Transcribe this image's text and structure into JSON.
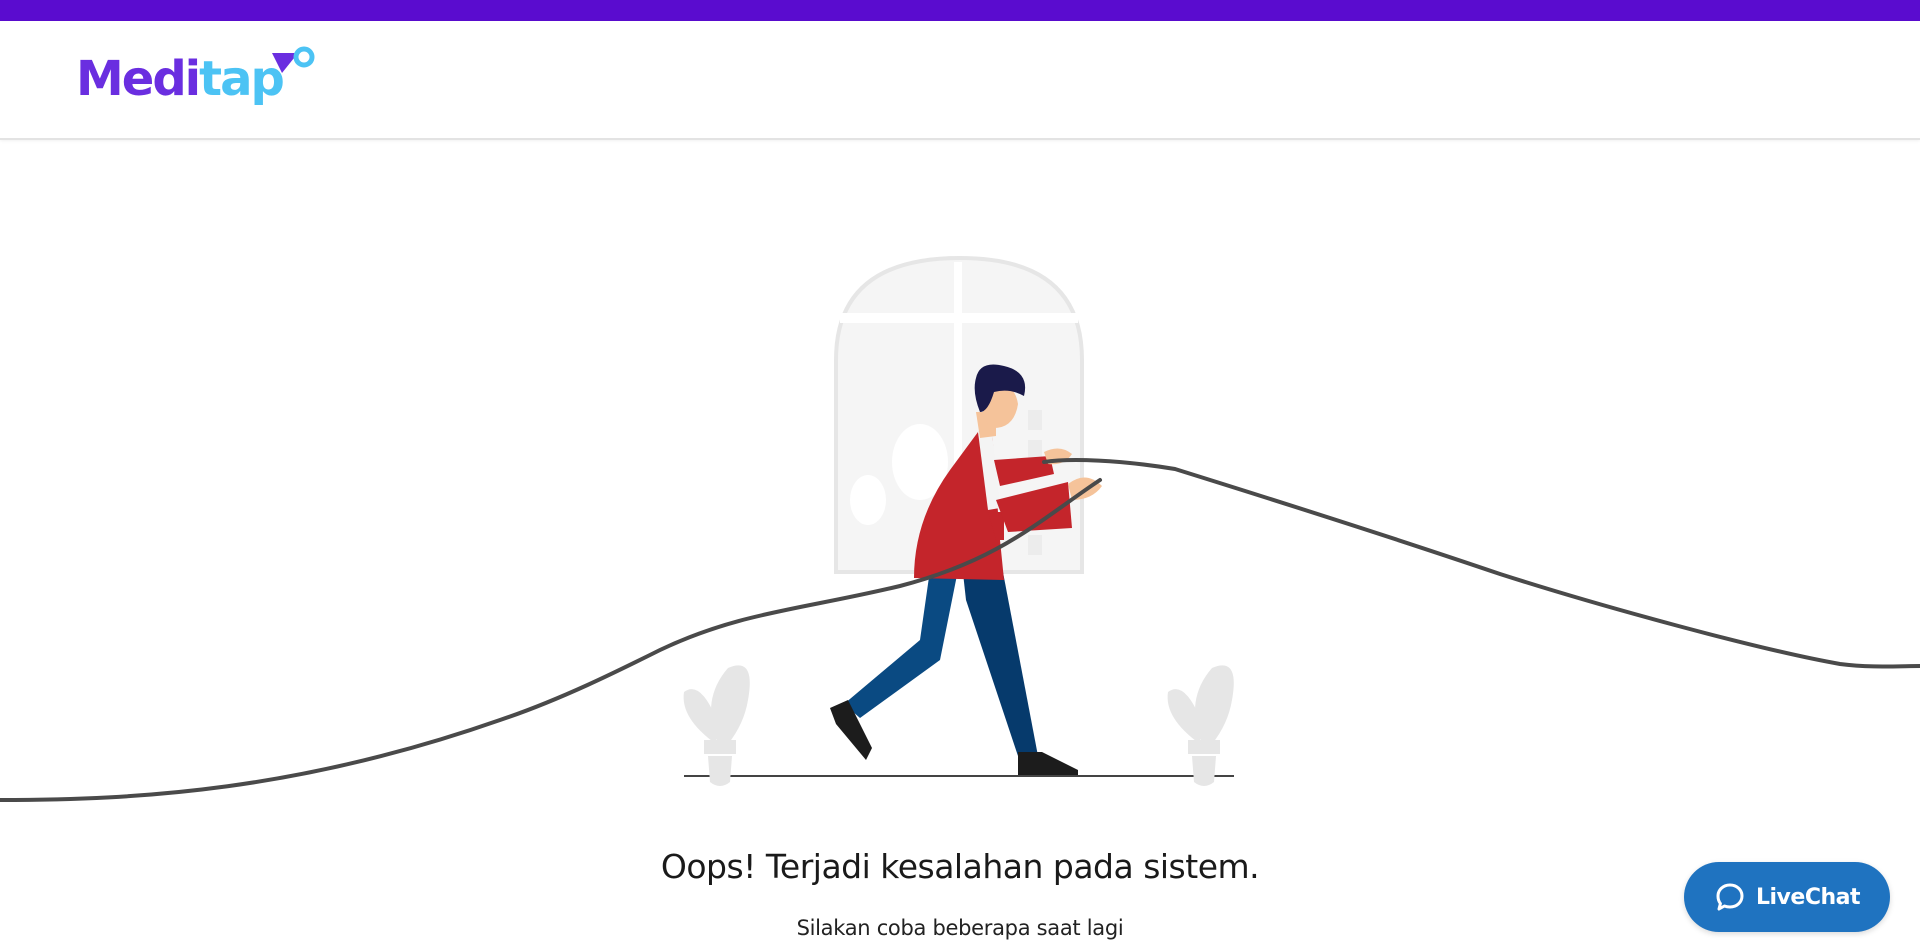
{
  "colors": {
    "top_bar": "#5a0ccf",
    "logo_primary": "#6a2ee0",
    "logo_secondary": "#4cc3f4",
    "livechat_button": "#1f73c0",
    "cable": "#4a4a4a",
    "jacket": "#c4252b",
    "pants": "#0a4a82"
  },
  "header": {
    "logo_part1": "Medi",
    "logo_part2": "tap"
  },
  "illustration": {
    "icon": "error-connection-illustration"
  },
  "error": {
    "title": "Oops! Terjadi kesalahan pada sistem.",
    "subtitle": "Silakan coba beberapa saat lagi"
  },
  "livechat": {
    "label": "LiveChat",
    "icon": "chat-bubble-icon"
  }
}
